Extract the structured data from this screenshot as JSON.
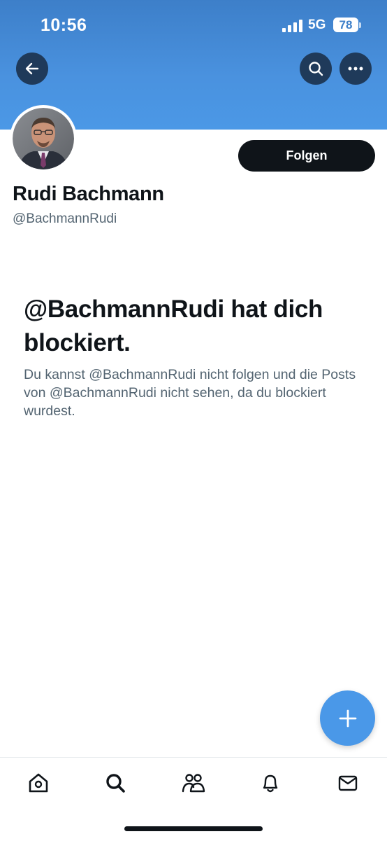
{
  "status_bar": {
    "time": "10:56",
    "network": "5G",
    "battery": "78"
  },
  "header": {
    "back_icon": "arrow-left-icon",
    "search_icon": "search-icon",
    "more_icon": "more-horizontal-icon",
    "banner_color": "#4a92df"
  },
  "profile": {
    "name": "Rudi Bachmann",
    "handle": "@BachmannRudi",
    "follow_label": "Folgen"
  },
  "blocked": {
    "title": "@BachmannRudi hat dich blockiert.",
    "description": "Du kannst @BachmannRudi nicht folgen und die Posts von @BachmannRudi nicht sehen, da du blockiert wurdest."
  },
  "fab": {
    "icon": "plus-icon",
    "color": "#4a98e8"
  },
  "tabbar": {
    "items": [
      {
        "name": "home",
        "icon": "home-icon"
      },
      {
        "name": "search",
        "icon": "search-icon"
      },
      {
        "name": "communities",
        "icon": "people-icon"
      },
      {
        "name": "notifications",
        "icon": "bell-icon"
      },
      {
        "name": "messages",
        "icon": "mail-icon"
      }
    ]
  }
}
